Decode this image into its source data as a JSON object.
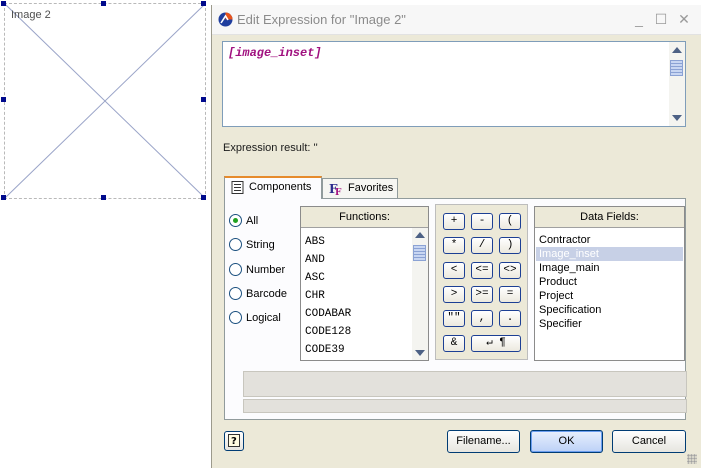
{
  "canvas": {
    "placeholder_label": "Image 2"
  },
  "dialog": {
    "title": "Edit Expression for \"Image 2\"",
    "window_controls": {
      "minimize": "_",
      "maximize": "☐",
      "close": "✕"
    },
    "expression_text": "[image_inset]",
    "expression_result_label": "Expression result: ''",
    "tabs": [
      {
        "label": "Components",
        "icon": "components-icon",
        "active": true
      },
      {
        "label": "Favorites",
        "icon": "favorites-icon",
        "active": false
      }
    ],
    "filter_options": [
      {
        "label": "All",
        "selected": true
      },
      {
        "label": "String",
        "selected": false
      },
      {
        "label": "Number",
        "selected": false
      },
      {
        "label": "Barcode",
        "selected": false
      },
      {
        "label": "Logical",
        "selected": false
      }
    ],
    "functions": {
      "header": "Functions:",
      "items": [
        "ABS",
        "AND",
        "ASC",
        "CHR",
        "CODABAR",
        "CODE128",
        "CODE39"
      ]
    },
    "operators": [
      "+",
      "-",
      "(",
      "*",
      "/",
      ")",
      "<",
      "<=",
      "<>",
      ">",
      ">=",
      "=",
      "\"\"",
      ",",
      ".",
      "&",
      "↵ ¶"
    ],
    "data_fields": {
      "header": "Data Fields:",
      "items": [
        "Contractor",
        "Image_inset",
        "Image_main",
        "Product",
        "Project",
        "Specification",
        "Specifier"
      ],
      "selected": "Image_inset"
    },
    "buttons": {
      "help": "?",
      "filename": "Filename...",
      "ok": "OK",
      "cancel": "Cancel"
    }
  }
}
